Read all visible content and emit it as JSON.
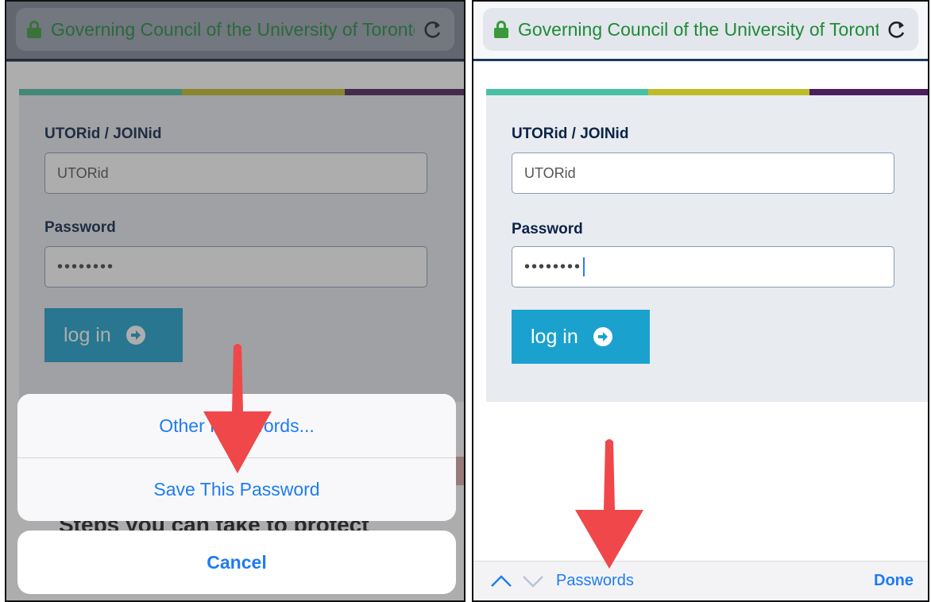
{
  "browser": {
    "url_text": "Governing Council of the University of Toronto"
  },
  "login_form": {
    "utorid_label": "UTORid / JOINid",
    "utorid_value": "UTORid",
    "password_label": "Password",
    "password_value": "••••••••",
    "login_button": "log in"
  },
  "action_sheet": {
    "other_passwords": "Other Passwords...",
    "save_password": "Save This Password",
    "cancel": "Cancel"
  },
  "background_text": "Steps you can take to protect",
  "keyboard_bar": {
    "passwords": "Passwords",
    "done": "Done"
  },
  "colors": {
    "accent": "#1e7cf2",
    "login_button": "#1ba1cd",
    "url_green": "#1f8a3a",
    "arrow_red": "#f0474a"
  }
}
